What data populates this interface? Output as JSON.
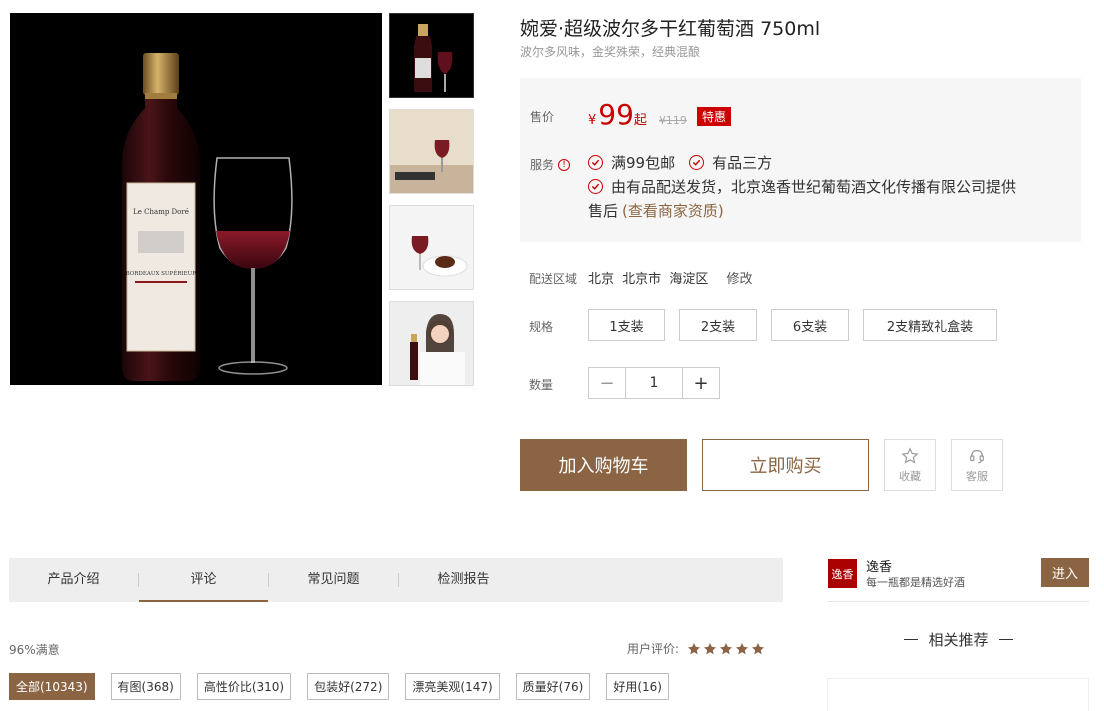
{
  "product": {
    "title": "婉爱·超级波尔多干红葡萄酒 750ml",
    "subtitle": "波尔多风味，金奖殊荣，经典混酿"
  },
  "price": {
    "label": "售价",
    "currency": "¥",
    "value": "99",
    "suffix": "起",
    "original": "¥119",
    "badge": "特惠"
  },
  "service": {
    "label": "服务",
    "info_icon": "info-circle-icon",
    "items": [
      "满99包邮",
      "有品三方"
    ],
    "detail_line1": "由有品配送发货，北京逸香世纪葡萄酒文化传播有限公司提供",
    "detail_line2": "售后",
    "detail_link": "(查看商家资质)"
  },
  "delivery": {
    "label": "配送区域",
    "province": "北京",
    "city": "北京市",
    "district": "海淀区",
    "edit": "修改"
  },
  "spec": {
    "label": "规格",
    "options": [
      "1支装",
      "2支装",
      "6支装",
      "2支精致礼盒装"
    ]
  },
  "quantity": {
    "label": "数量",
    "minus": "−",
    "value": "1",
    "plus": "+"
  },
  "actions": {
    "add_to_cart": "加入购物车",
    "buy_now": "立即购买",
    "favorite": "收藏",
    "service": "客服"
  },
  "tabs": [
    "产品介绍",
    "评论",
    "常见问题",
    "检测报告"
  ],
  "reviews": {
    "satisfaction": "96%满意",
    "rating_label": "用户评价:",
    "stars": 5,
    "filters": [
      "全部(10343)",
      "有图(368)",
      "高性价比(310)",
      "包装好(272)",
      "漂亮美观(147)",
      "质量好(76)",
      "好用(16)"
    ]
  },
  "shop": {
    "logo_text": "逸香",
    "name": "逸香",
    "slogan": "每一瓶都是精选好酒",
    "enter": "进入"
  },
  "sidebar": {
    "related_title": "相关推荐"
  },
  "bottle_label": {
    "brand": "Le Champ Doré",
    "appellation": "BORDEAUX SUPÉRIEUR"
  },
  "colors": {
    "accent": "#8b6543",
    "price": "#cc0000"
  }
}
